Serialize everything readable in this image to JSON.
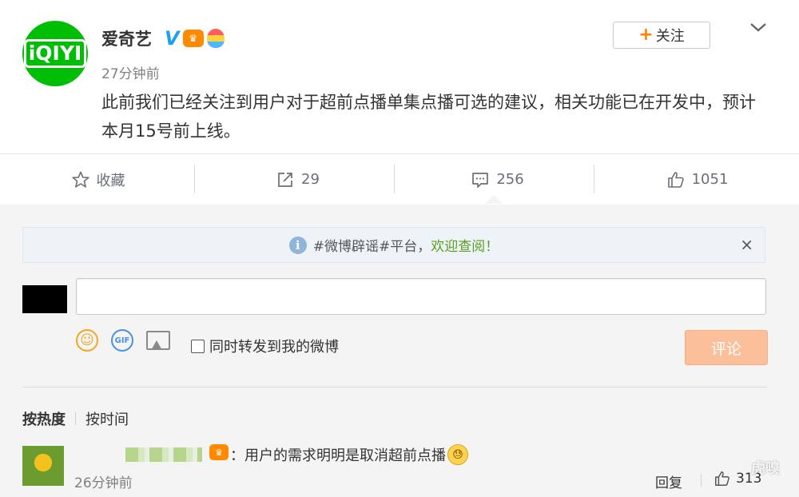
{
  "post": {
    "author": "爱奇艺",
    "logo_text": "iQIYI",
    "time": "27分钟前",
    "content": "此前我们已经关注到用户对于超前点播单集点播可选的建议，相关功能已在开发中，预计本月15号前上线。",
    "follow_label": "关注",
    "verified_badge": "V"
  },
  "actions": {
    "favorite_label": "收藏",
    "repost_count": "29",
    "comment_count": "256",
    "like_count": "1051"
  },
  "notice": {
    "prefix": "#微博辟谣#平台，",
    "link": "欢迎查阅！",
    "close": "×"
  },
  "composer": {
    "input_value": "",
    "repost_label": "同时转发到我的微博",
    "submit_label": "评论",
    "gif_label": "GIF"
  },
  "sort": {
    "by_heat": "按热度",
    "by_time": "按时间"
  },
  "comment": {
    "text": "：用户的需求明明是取消超前点播",
    "time": "26分钟前",
    "reply_label": "回复",
    "like_count": "313"
  },
  "watermark": "虎嗅",
  "colors": {
    "brand_green": "#00be06",
    "accent_orange": "#ff8200",
    "submit_disabled": "#fbbf9a",
    "link_green": "#5c9e1e"
  }
}
